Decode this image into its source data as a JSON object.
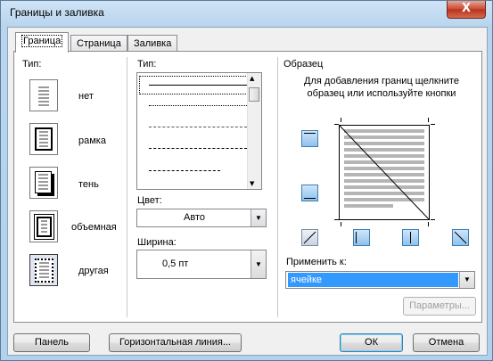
{
  "window": {
    "title": "Границы и заливка",
    "close_symbol": "X"
  },
  "tabs": [
    {
      "label": "Граница",
      "active": true
    },
    {
      "label": "Страница",
      "active": false
    },
    {
      "label": "Заливка",
      "active": false
    }
  ],
  "setting": {
    "label": "Тип:",
    "options": [
      {
        "label": "нет",
        "icon": "no-border-icon"
      },
      {
        "label": "рамка",
        "icon": "box-border-icon"
      },
      {
        "label": "тень",
        "icon": "shadow-border-icon"
      },
      {
        "label": "объемная",
        "icon": "3d-border-icon"
      },
      {
        "label": "другая",
        "icon": "custom-border-icon",
        "selected": true
      }
    ]
  },
  "style": {
    "label": "Тип:",
    "line_styles": [
      "solid",
      "dotted",
      "dashed-fine",
      "dashed",
      "dash-dot"
    ]
  },
  "color": {
    "label": "Цвет:",
    "value": "Авто"
  },
  "width": {
    "label": "Ширина:",
    "value": "0,5 пт"
  },
  "preview": {
    "label": "Образец",
    "hint": "Для добавления границ щелкните образец или используйте кнопки"
  },
  "apply_to": {
    "label": "Применить к:",
    "value": "ячейке"
  },
  "buttons": {
    "options": "Параметры...",
    "panel": "Панель",
    "horizontal_line": "Горизонтальная линия...",
    "ok": "ОК",
    "cancel": "Отмена"
  },
  "colors": {
    "title_bar": "#b9d5ee",
    "close_button": "#c7482e",
    "selection": "#3399ff"
  }
}
